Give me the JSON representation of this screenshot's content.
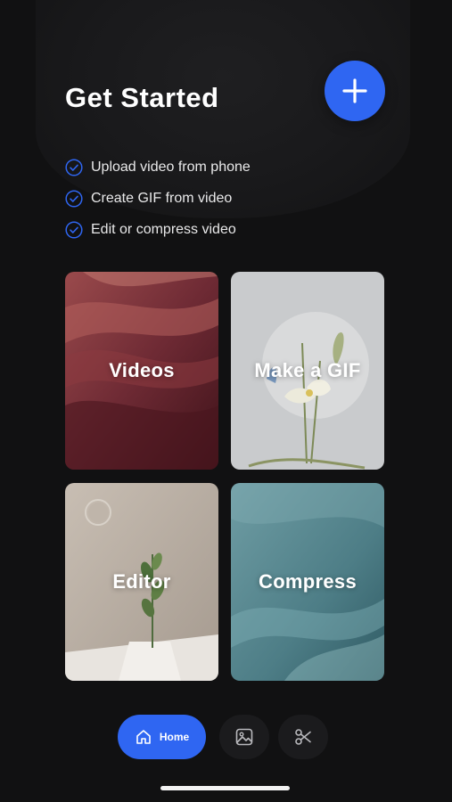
{
  "header": {
    "title": "Get Started",
    "add_icon": "plus-icon",
    "add_button_color": "#2f66f2"
  },
  "checklist": [
    {
      "icon": "check-circle-icon",
      "text": "Upload video from phone"
    },
    {
      "icon": "check-circle-icon",
      "text": "Create GIF from video"
    },
    {
      "icon": "check-circle-icon",
      "text": "Edit or compress video"
    }
  ],
  "tiles": [
    {
      "label": "Videos"
    },
    {
      "label": "Make a GIF"
    },
    {
      "label": "Editor"
    },
    {
      "label": "Compress"
    }
  ],
  "nav": {
    "home_label": "Home",
    "home_icon": "home-icon",
    "gallery_icon": "image-icon",
    "cut_icon": "scissors-icon",
    "active_color": "#2f66f2"
  }
}
